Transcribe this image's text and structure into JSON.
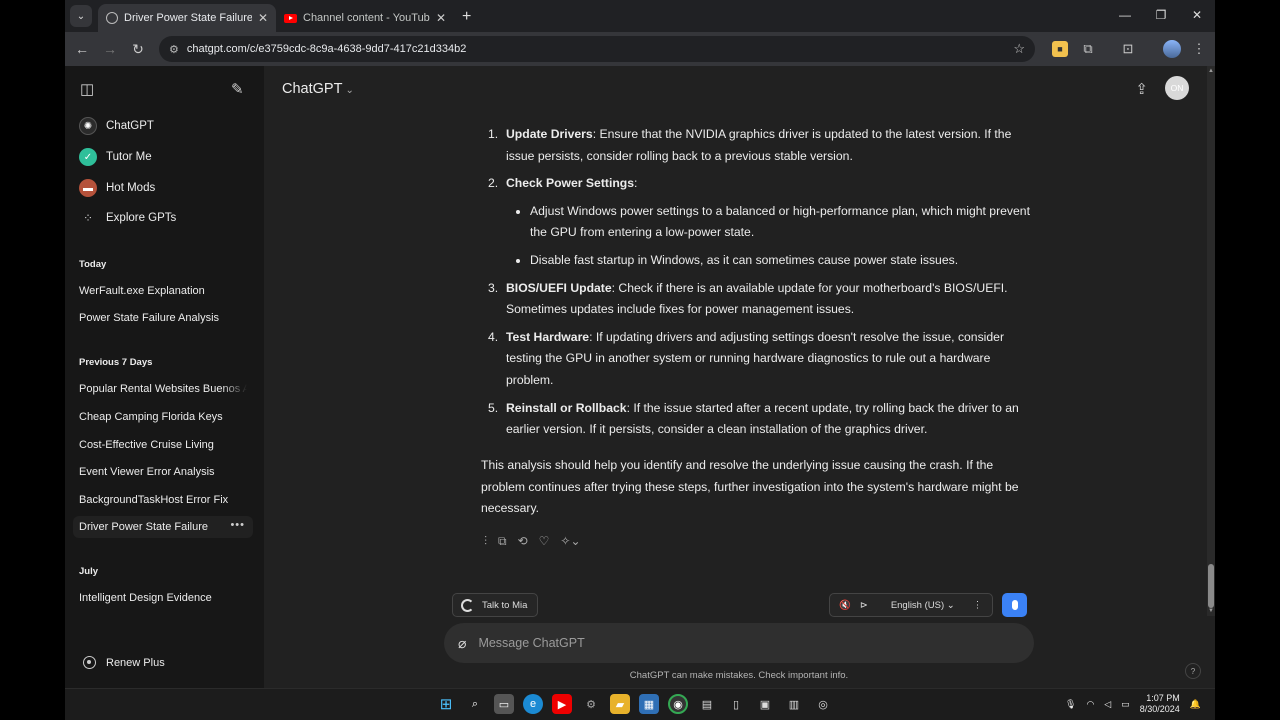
{
  "browser": {
    "tabs": [
      {
        "title": "Driver Power State Failure",
        "active": true
      },
      {
        "title": "Channel content - YouTube Studio",
        "active": false
      }
    ],
    "new_tab": "+",
    "url": "chatgpt.com/c/e3759cdc-8c9a-4638-9dd7-417c21d334b2",
    "window_controls": [
      "—",
      "❐",
      "✕"
    ]
  },
  "sidebar": {
    "pinned": [
      {
        "label": "ChatGPT",
        "icon": "openai-logo-icon",
        "color": "#2b2b2b"
      },
      {
        "label": "Tutor Me",
        "icon": "tutor-me-icon",
        "color": "#2fbf9a"
      },
      {
        "label": "Hot Mods",
        "icon": "hot-mods-icon",
        "color": "#b5523b"
      },
      {
        "label": "Explore GPTs",
        "icon": "grid-icon",
        "color": "transparent"
      }
    ],
    "sections": [
      {
        "title": "Today",
        "items": [
          "WerFault.exe Explanation",
          "Power State Failure Analysis"
        ]
      },
      {
        "title": "Previous 7 Days",
        "items": [
          "Popular Rental Websites Buenos Aires",
          "Cheap Camping Florida Keys",
          "Cost-Effective Cruise Living",
          "Event Viewer Error Analysis",
          "BackgroundTaskHost Error Fix",
          "Driver Power State Failure"
        ]
      },
      {
        "title": "July",
        "items": [
          "Intelligent Design Evidence"
        ]
      }
    ],
    "active_item": "Driver Power State Failure",
    "renew": "Renew Plus"
  },
  "header": {
    "model": "ChatGPT",
    "avatar_initials": "ON"
  },
  "answer": {
    "steps": [
      {
        "n": "1.",
        "title": "Update Drivers",
        "text": ": Ensure that the NVIDIA graphics driver is updated to the latest version. If the issue persists, consider rolling back to a previous stable version."
      },
      {
        "n": "2.",
        "title": "Check Power Settings",
        "text": ":",
        "bullets": [
          "Adjust Windows power settings to a balanced or high-performance plan, which might prevent the GPU from entering a low-power state.",
          "Disable fast startup in Windows, as it can sometimes cause power state issues."
        ]
      },
      {
        "n": "3.",
        "title": "BIOS/UEFI Update",
        "text": ": Check if there is an available update for your motherboard's BIOS/UEFI. Sometimes updates include fixes for power management issues."
      },
      {
        "n": "4.",
        "title": "Test Hardware",
        "text": ": If updating drivers and adjusting settings doesn't resolve the issue, consider testing the GPU in another system or running hardware diagnostics to rule out a hardware problem."
      },
      {
        "n": "5.",
        "title": "Reinstall or Rollback",
        "text": ": If the issue started after a recent update, try rolling back the driver to an earlier version. If it persists, consider a clean installation of the graphics driver."
      }
    ],
    "summary": "This analysis should help you identify and resolve the underlying issue causing the crash. If the problem continues after trying these steps, further investigation into the system's hardware might be necessary."
  },
  "voice": {
    "talk_label": "Talk to Mia",
    "language": "English (US)"
  },
  "composer": {
    "placeholder": "Message ChatGPT",
    "disclaimer": "ChatGPT can make mistakes. Check important info.",
    "help": "?"
  },
  "taskbar": {
    "time": "1:07 PM",
    "date": "8/30/2024"
  },
  "colors": {
    "sidebar_bg": "#171717",
    "main_bg": "#212121",
    "accent_blue": "#3b82f6"
  }
}
